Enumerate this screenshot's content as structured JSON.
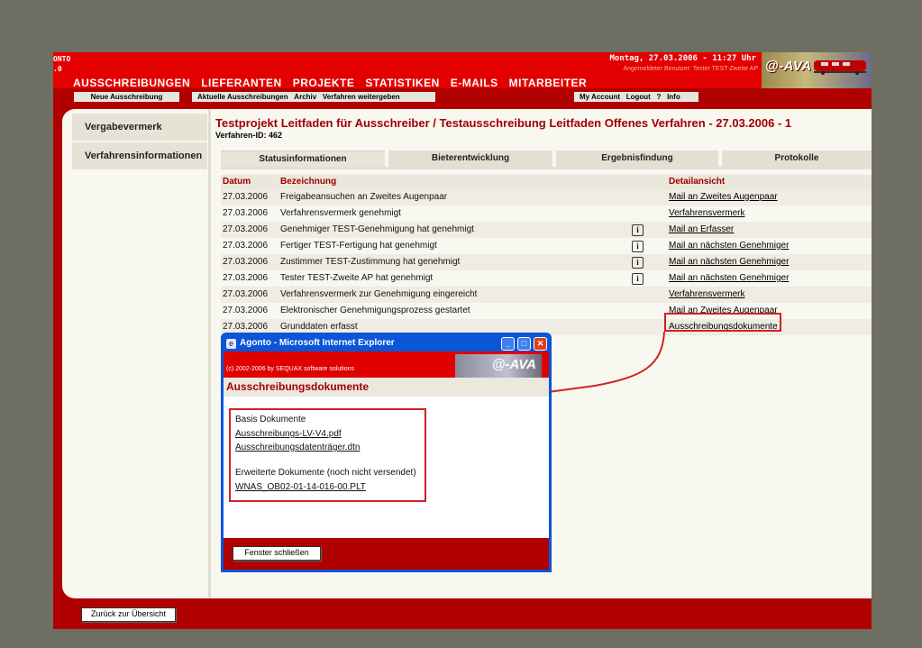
{
  "header": {
    "brand_cut_top": "ONTO",
    "brand_cut_bottom": ".0",
    "dateline": "Montag, 27.03.2006 - 11:27 Uhr",
    "userline": "Angemeldeter Benutzer: Tester TEST-Zweite AP",
    "logo": "@-AVA",
    "main_nav": [
      "AUSSCHREIBUNGEN",
      "LIEFERANTEN",
      "PROJEKTE",
      "STATISTIKEN",
      "E-MAILS",
      "MITARBEITER"
    ],
    "sub_nav": {
      "neue": "Neue Ausschreibung",
      "aktuelle": "Aktuelle Ausschreibungen",
      "archiv": "Archiv",
      "weitergeben": "Verfahren weitergeben",
      "account": "My Account",
      "logout": "Logout",
      "help": "?",
      "info": "Info"
    }
  },
  "sidebar": {
    "items": [
      "Vergabevermerk",
      "Verfahrensinformationen"
    ]
  },
  "page": {
    "title": "Testprojekt Leitfaden für Ausschreiber / Testausschreibung Leitfaden Offenes Verfahren - 27.03.2006 - 1",
    "procedure_id": "Verfahren-ID: 462"
  },
  "tabs": [
    "Statusinformationen",
    "Bieterentwicklung",
    "Ergebnisfindung",
    "Protokolle"
  ],
  "table": {
    "headers": {
      "datum": "Datum",
      "bezeichnung": "Bezeichnung",
      "detail": "Detailansicht"
    },
    "info_glyph": "i",
    "rows": [
      {
        "date": "27.03.2006",
        "desc": "Freigabeansuchen an Zweites Augenpaar",
        "link": "Mail an Zweites Augenpaar",
        "info": false
      },
      {
        "date": "27.03.2006",
        "desc": "Verfahrensvermerk genehmigt",
        "link": "Verfahrensvermerk",
        "info": false
      },
      {
        "date": "27.03.2006",
        "desc": "Genehmiger TEST-Genehmigung hat genehmigt",
        "link": "Mail an Erfasser",
        "info": true
      },
      {
        "date": "27.03.2006",
        "desc": "Fertiger TEST-Fertigung hat genehmigt",
        "link": "Mail an nächsten Genehmiger",
        "info": true
      },
      {
        "date": "27.03.2006",
        "desc": "Zustimmer TEST-Zustimmung hat genehmigt",
        "link": "Mail an nächsten Genehmiger",
        "info": true
      },
      {
        "date": "27.03.2006",
        "desc": "Tester TEST-Zweite AP hat genehmigt",
        "link": "Mail an nächsten Genehmiger",
        "info": true
      },
      {
        "date": "27.03.2006",
        "desc": "Verfahrensvermerk zur Genehmigung eingereicht",
        "link": "Verfahrensvermerk",
        "info": false
      },
      {
        "date": "27.03.2006",
        "desc": "Elektronischer Genehmigungsprozess gestartet",
        "link": "Mail an Zweites Augenpaar",
        "info": false
      },
      {
        "date": "27.03.2006",
        "desc": "Grunddaten erfasst",
        "link": "Ausschreibungsdokumente",
        "info": false
      }
    ]
  },
  "popup": {
    "window_title": "Agonto - Microsoft Internet Explorer",
    "ie_glyph": "e",
    "min_glyph": "_",
    "max_glyph": "□",
    "close_glyph": "✕",
    "copyright": "(c) 2002-2006 by SEQUAX software solutions",
    "logo": "@-AVA",
    "heading": "Ausschreibungsdokumente",
    "basis_label": "Basis Dokumente",
    "basis_docs": [
      "Ausschreibungs-LV-V4.pdf",
      "Ausschreibungsdatenträger.dtn"
    ],
    "extended_label": "Erweiterte Dokumente (noch nicht versendet)",
    "extended_docs": [
      "WNAS_OB02-01-14-016-00.PLT"
    ],
    "close_button": "Fenster schließen"
  },
  "footer": {
    "back_button": "Zurück zur Übersicht"
  },
  "colors": {
    "brand_red": "#e30000",
    "dark_red": "#b00000",
    "highlight": "#d42020"
  }
}
